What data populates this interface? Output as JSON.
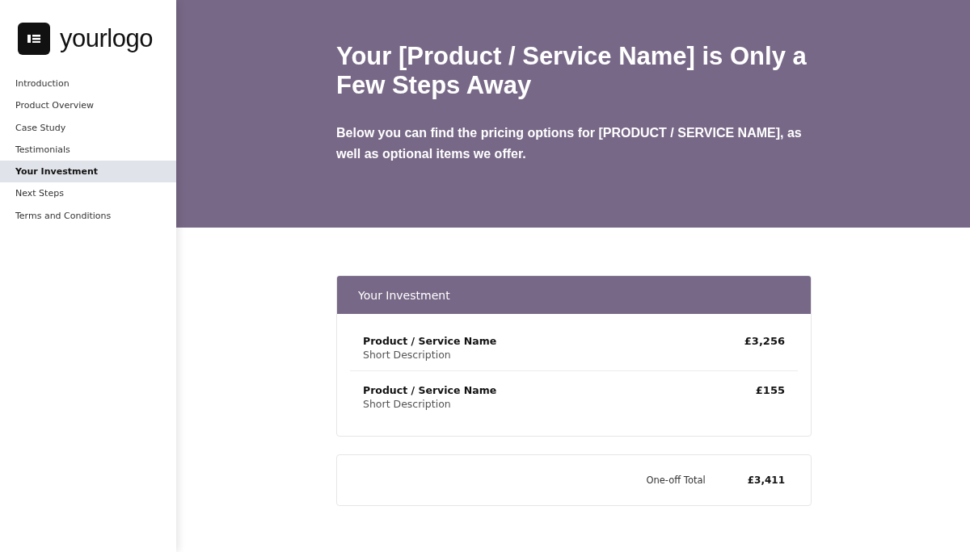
{
  "logo": {
    "text": "**your**logo"
  },
  "sidebar": {
    "items": [
      {
        "label": "Introduction",
        "selected": false
      },
      {
        "label": "Product Overview",
        "selected": false
      },
      {
        "label": "Case Study",
        "selected": false
      },
      {
        "label": "Testimonials",
        "selected": false
      },
      {
        "label": "Your Investment",
        "selected": true
      },
      {
        "label": "Next Steps",
        "selected": false
      },
      {
        "label": "Terms and Conditions",
        "selected": false
      }
    ]
  },
  "hero": {
    "title": "Your [Product / Service Name] is Only a Few Steps Away",
    "subtitle": "Below you can find the pricing options for [PRODUCT / SERVICE NAME], as well as optional items we offer."
  },
  "investment": {
    "title": "Your Investment",
    "items": [
      {
        "name": "Product / Service Name",
        "description": "Short Description",
        "price": "£3,256"
      },
      {
        "name": "Product / Service Name",
        "description": "Short Description",
        "price": "£155"
      }
    ]
  },
  "total": {
    "label": "One-off Total",
    "value": "£3,411"
  }
}
